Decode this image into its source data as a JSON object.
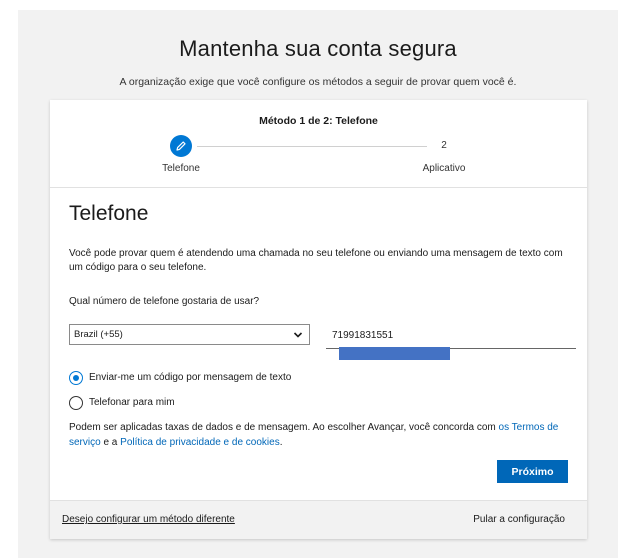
{
  "page": {
    "title": "Mantenha sua conta segura",
    "subtitle": "A organização exige que você configure os métodos a seguir de provar quem você é."
  },
  "stepper": {
    "method_label": "Método 1 de 2: Telefone",
    "steps": [
      {
        "number": "1",
        "label": "Telefone",
        "state": "current",
        "icon": "pencil-icon"
      },
      {
        "number": "2",
        "label": "Aplicativo",
        "state": "pending"
      }
    ]
  },
  "form": {
    "section_title": "Telefone",
    "description": "Você pode provar quem é atendendo uma chamada no seu telefone ou enviando uma mensagem de texto com um código para o seu telefone.",
    "question": "Qual número de telefone gostaria de usar?",
    "country": {
      "value": "Brazil (+55)"
    },
    "phone": {
      "value": "71991831551"
    },
    "options": [
      {
        "label": "Enviar-me um código por mensagem de texto",
        "checked": true
      },
      {
        "label": "Telefonar para mim",
        "checked": false
      }
    ],
    "terms": {
      "before": "Podem ser aplicadas taxas de dados e de mensagem. Ao escolher Avançar, você concorda com ",
      "terms_link": "os Termos de serviço",
      "middle": " e a ",
      "privacy_link": "Política de privacidade e de cookies",
      "after": "."
    },
    "next_label": "Próximo"
  },
  "footer": {
    "different_method": "Desejo configurar um método diferente",
    "skip": "Pular a configuração"
  },
  "colors": {
    "accent": "#0078d4",
    "button": "#0067b8",
    "link": "#0067b8",
    "redaction": "#4472c4"
  }
}
